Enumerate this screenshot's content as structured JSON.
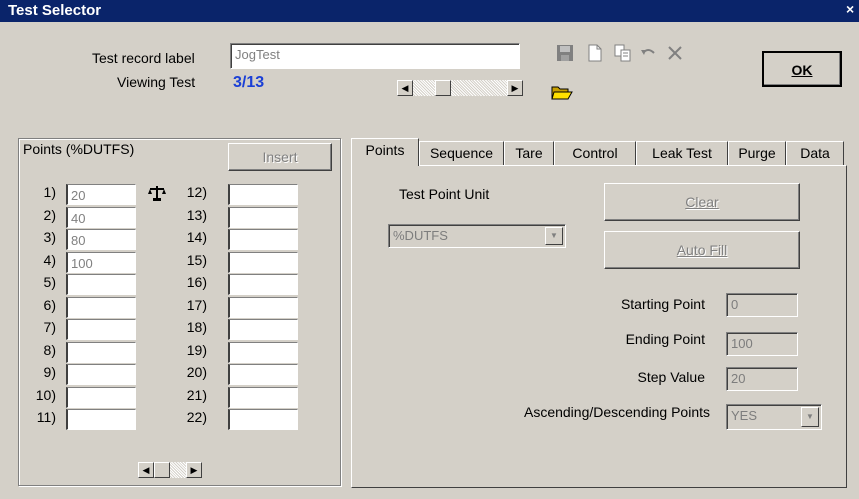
{
  "window": {
    "title": "Test Selector",
    "close_glyph": "×"
  },
  "header": {
    "record_label": "Test record label",
    "record_value": "JogTest",
    "viewing_label": "Viewing Test",
    "viewing_value": "3/13",
    "ok_label": "OK"
  },
  "points_group": {
    "title": "Points (%DUTFS)",
    "insert_label": "Insert",
    "left": [
      {
        "n": "1)",
        "v": "20"
      },
      {
        "n": "2)",
        "v": "40"
      },
      {
        "n": "3)",
        "v": "80"
      },
      {
        "n": "4)",
        "v": "100"
      },
      {
        "n": "5)",
        "v": ""
      },
      {
        "n": "6)",
        "v": ""
      },
      {
        "n": "7)",
        "v": ""
      },
      {
        "n": "8)",
        "v": ""
      },
      {
        "n": "9)",
        "v": ""
      },
      {
        "n": "10)",
        "v": ""
      },
      {
        "n": "11)",
        "v": ""
      }
    ],
    "right": [
      {
        "n": "12)",
        "v": ""
      },
      {
        "n": "13)",
        "v": ""
      },
      {
        "n": "14)",
        "v": ""
      },
      {
        "n": "15)",
        "v": ""
      },
      {
        "n": "16)",
        "v": ""
      },
      {
        "n": "17)",
        "v": ""
      },
      {
        "n": "18)",
        "v": ""
      },
      {
        "n": "19)",
        "v": ""
      },
      {
        "n": "20)",
        "v": ""
      },
      {
        "n": "21)",
        "v": ""
      },
      {
        "n": "22)",
        "v": ""
      }
    ]
  },
  "tabs": [
    "Points",
    "Sequence",
    "Tare",
    "Control",
    "Leak Test",
    "Purge",
    "Data"
  ],
  "points_tab": {
    "unit_label": "Test Point Unit",
    "unit_value": "%DUTFS",
    "clear_label": "Clear",
    "autofill_label": "Auto Fill",
    "start_label": "Starting Point",
    "start_value": "0",
    "end_label": "Ending Point",
    "end_value": "100",
    "step_label": "Step Value",
    "step_value": "20",
    "asc_label": "Ascending/Descending Points",
    "asc_value": "YES"
  },
  "colors": {
    "title_bar": "#0a246a",
    "viewing_value": "#1a3fd6",
    "face": "#d4d0c8"
  },
  "icons": [
    "save-icon",
    "new-document-icon",
    "copy-icon",
    "undo-icon",
    "delete-icon",
    "open-folder-icon",
    "scale-icon"
  ]
}
